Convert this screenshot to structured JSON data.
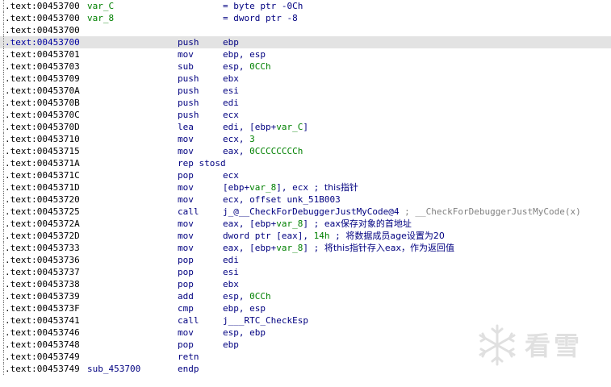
{
  "listing": {
    "rows": [
      {
        "addr": ".text:00453700",
        "label": "var_C",
        "label_type": "var",
        "mnem": "",
        "ops": [
          {
            "t": "= byte ptr -0Ch",
            "c": "plain"
          }
        ]
      },
      {
        "addr": ".text:00453700",
        "label": "var_8",
        "label_type": "var",
        "mnem": "",
        "ops": [
          {
            "t": "= dword ptr -8",
            "c": "plain"
          }
        ]
      },
      {
        "addr": ".text:00453700",
        "label": "",
        "label_type": "",
        "mnem": "",
        "ops": []
      },
      {
        "addr": ".text:00453700",
        "label": "",
        "label_type": "",
        "mnem": "push",
        "ops": [
          {
            "t": "ebp",
            "c": "plain"
          }
        ],
        "selected": true
      },
      {
        "addr": ".text:00453701",
        "label": "",
        "label_type": "",
        "mnem": "mov",
        "ops": [
          {
            "t": "ebp, esp",
            "c": "plain"
          }
        ]
      },
      {
        "addr": ".text:00453703",
        "label": "",
        "label_type": "",
        "mnem": "sub",
        "ops": [
          {
            "t": "esp, ",
            "c": "plain"
          },
          {
            "t": "0CCh",
            "c": "num"
          }
        ]
      },
      {
        "addr": ".text:00453709",
        "label": "",
        "label_type": "",
        "mnem": "push",
        "ops": [
          {
            "t": "ebx",
            "c": "plain"
          }
        ]
      },
      {
        "addr": ".text:0045370A",
        "label": "",
        "label_type": "",
        "mnem": "push",
        "ops": [
          {
            "t": "esi",
            "c": "plain"
          }
        ]
      },
      {
        "addr": ".text:0045370B",
        "label": "",
        "label_type": "",
        "mnem": "push",
        "ops": [
          {
            "t": "edi",
            "c": "plain"
          }
        ]
      },
      {
        "addr": ".text:0045370C",
        "label": "",
        "label_type": "",
        "mnem": "push",
        "ops": [
          {
            "t": "ecx",
            "c": "plain"
          }
        ]
      },
      {
        "addr": ".text:0045370D",
        "label": "",
        "label_type": "",
        "mnem": "lea",
        "ops": [
          {
            "t": "edi, [ebp+",
            "c": "plain"
          },
          {
            "t": "var_C",
            "c": "var"
          },
          {
            "t": "]",
            "c": "plain"
          }
        ]
      },
      {
        "addr": ".text:00453710",
        "label": "",
        "label_type": "",
        "mnem": "mov",
        "ops": [
          {
            "t": "ecx, ",
            "c": "plain"
          },
          {
            "t": "3",
            "c": "num"
          }
        ]
      },
      {
        "addr": ".text:00453715",
        "label": "",
        "label_type": "",
        "mnem": "mov",
        "ops": [
          {
            "t": "eax, ",
            "c": "plain"
          },
          {
            "t": "0CCCCCCCCh",
            "c": "num"
          }
        ]
      },
      {
        "addr": ".text:0045371A",
        "label": "",
        "label_type": "",
        "mnem": "rep stosd",
        "ops": []
      },
      {
        "addr": ".text:0045371C",
        "label": "",
        "label_type": "",
        "mnem": "pop",
        "ops": [
          {
            "t": "ecx",
            "c": "plain"
          }
        ]
      },
      {
        "addr": ".text:0045371D",
        "label": "",
        "label_type": "",
        "mnem": "mov",
        "ops": [
          {
            "t": "[ebp+",
            "c": "plain"
          },
          {
            "t": "var_8",
            "c": "var"
          },
          {
            "t": "], ecx ; ",
            "c": "plain"
          },
          {
            "t": "this指针",
            "c": "cmt"
          }
        ]
      },
      {
        "addr": ".text:00453720",
        "label": "",
        "label_type": "",
        "mnem": "mov",
        "ops": [
          {
            "t": "ecx, offset unk_51B003",
            "c": "plain"
          }
        ]
      },
      {
        "addr": ".text:00453725",
        "label": "",
        "label_type": "",
        "mnem": "call",
        "ops": [
          {
            "t": "j_@__CheckForDebuggerJustMyCode@4",
            "c": "plain"
          },
          {
            "t": " ; __CheckForDebuggerJustMyCode(x)",
            "c": "cmtgray"
          }
        ]
      },
      {
        "addr": ".text:0045372A",
        "label": "",
        "label_type": "",
        "mnem": "mov",
        "ops": [
          {
            "t": "eax, [ebp+",
            "c": "plain"
          },
          {
            "t": "var_8",
            "c": "var"
          },
          {
            "t": "] ; ",
            "c": "plain"
          },
          {
            "t": "eax保存对象的首地址",
            "c": "cmt"
          }
        ]
      },
      {
        "addr": ".text:0045372D",
        "label": "",
        "label_type": "",
        "mnem": "mov",
        "ops": [
          {
            "t": "dword ptr [eax], ",
            "c": "plain"
          },
          {
            "t": "14h",
            "c": "num"
          },
          {
            "t": " ; ",
            "c": "plain"
          },
          {
            "t": "将数据成员age设置为20",
            "c": "cmt"
          }
        ]
      },
      {
        "addr": ".text:00453733",
        "label": "",
        "label_type": "",
        "mnem": "mov",
        "ops": [
          {
            "t": "eax, [ebp+",
            "c": "plain"
          },
          {
            "t": "var_8",
            "c": "var"
          },
          {
            "t": "] ; ",
            "c": "plain"
          },
          {
            "t": "将this指针存入eax，作为返回值",
            "c": "cmt"
          }
        ]
      },
      {
        "addr": ".text:00453736",
        "label": "",
        "label_type": "",
        "mnem": "pop",
        "ops": [
          {
            "t": "edi",
            "c": "plain"
          }
        ]
      },
      {
        "addr": ".text:00453737",
        "label": "",
        "label_type": "",
        "mnem": "pop",
        "ops": [
          {
            "t": "esi",
            "c": "plain"
          }
        ]
      },
      {
        "addr": ".text:00453738",
        "label": "",
        "label_type": "",
        "mnem": "pop",
        "ops": [
          {
            "t": "ebx",
            "c": "plain"
          }
        ]
      },
      {
        "addr": ".text:00453739",
        "label": "",
        "label_type": "",
        "mnem": "add",
        "ops": [
          {
            "t": "esp, ",
            "c": "plain"
          },
          {
            "t": "0CCh",
            "c": "num"
          }
        ]
      },
      {
        "addr": ".text:0045373F",
        "label": "",
        "label_type": "",
        "mnem": "cmp",
        "ops": [
          {
            "t": "ebp, esp",
            "c": "plain"
          }
        ]
      },
      {
        "addr": ".text:00453741",
        "label": "",
        "label_type": "",
        "mnem": "call",
        "ops": [
          {
            "t": "j___RTC_CheckEsp",
            "c": "plain"
          }
        ]
      },
      {
        "addr": ".text:00453746",
        "label": "",
        "label_type": "",
        "mnem": "mov",
        "ops": [
          {
            "t": "esp, ebp",
            "c": "plain"
          }
        ]
      },
      {
        "addr": ".text:00453748",
        "label": "",
        "label_type": "",
        "mnem": "pop",
        "ops": [
          {
            "t": "ebp",
            "c": "plain"
          }
        ]
      },
      {
        "addr": ".text:00453749",
        "label": "",
        "label_type": "",
        "mnem": "retn",
        "ops": []
      },
      {
        "addr": ".text:00453749",
        "label": "sub_453700",
        "label_type": "sub",
        "mnem": "endp",
        "ops": []
      }
    ]
  },
  "watermark": {
    "text": "看雪",
    "icon": "snowflake-icon"
  },
  "colors": {
    "address": "#000000",
    "instruction": "#000080",
    "variable": "#008000",
    "comment_gray": "#808080",
    "selection": "#e3e3e3"
  }
}
